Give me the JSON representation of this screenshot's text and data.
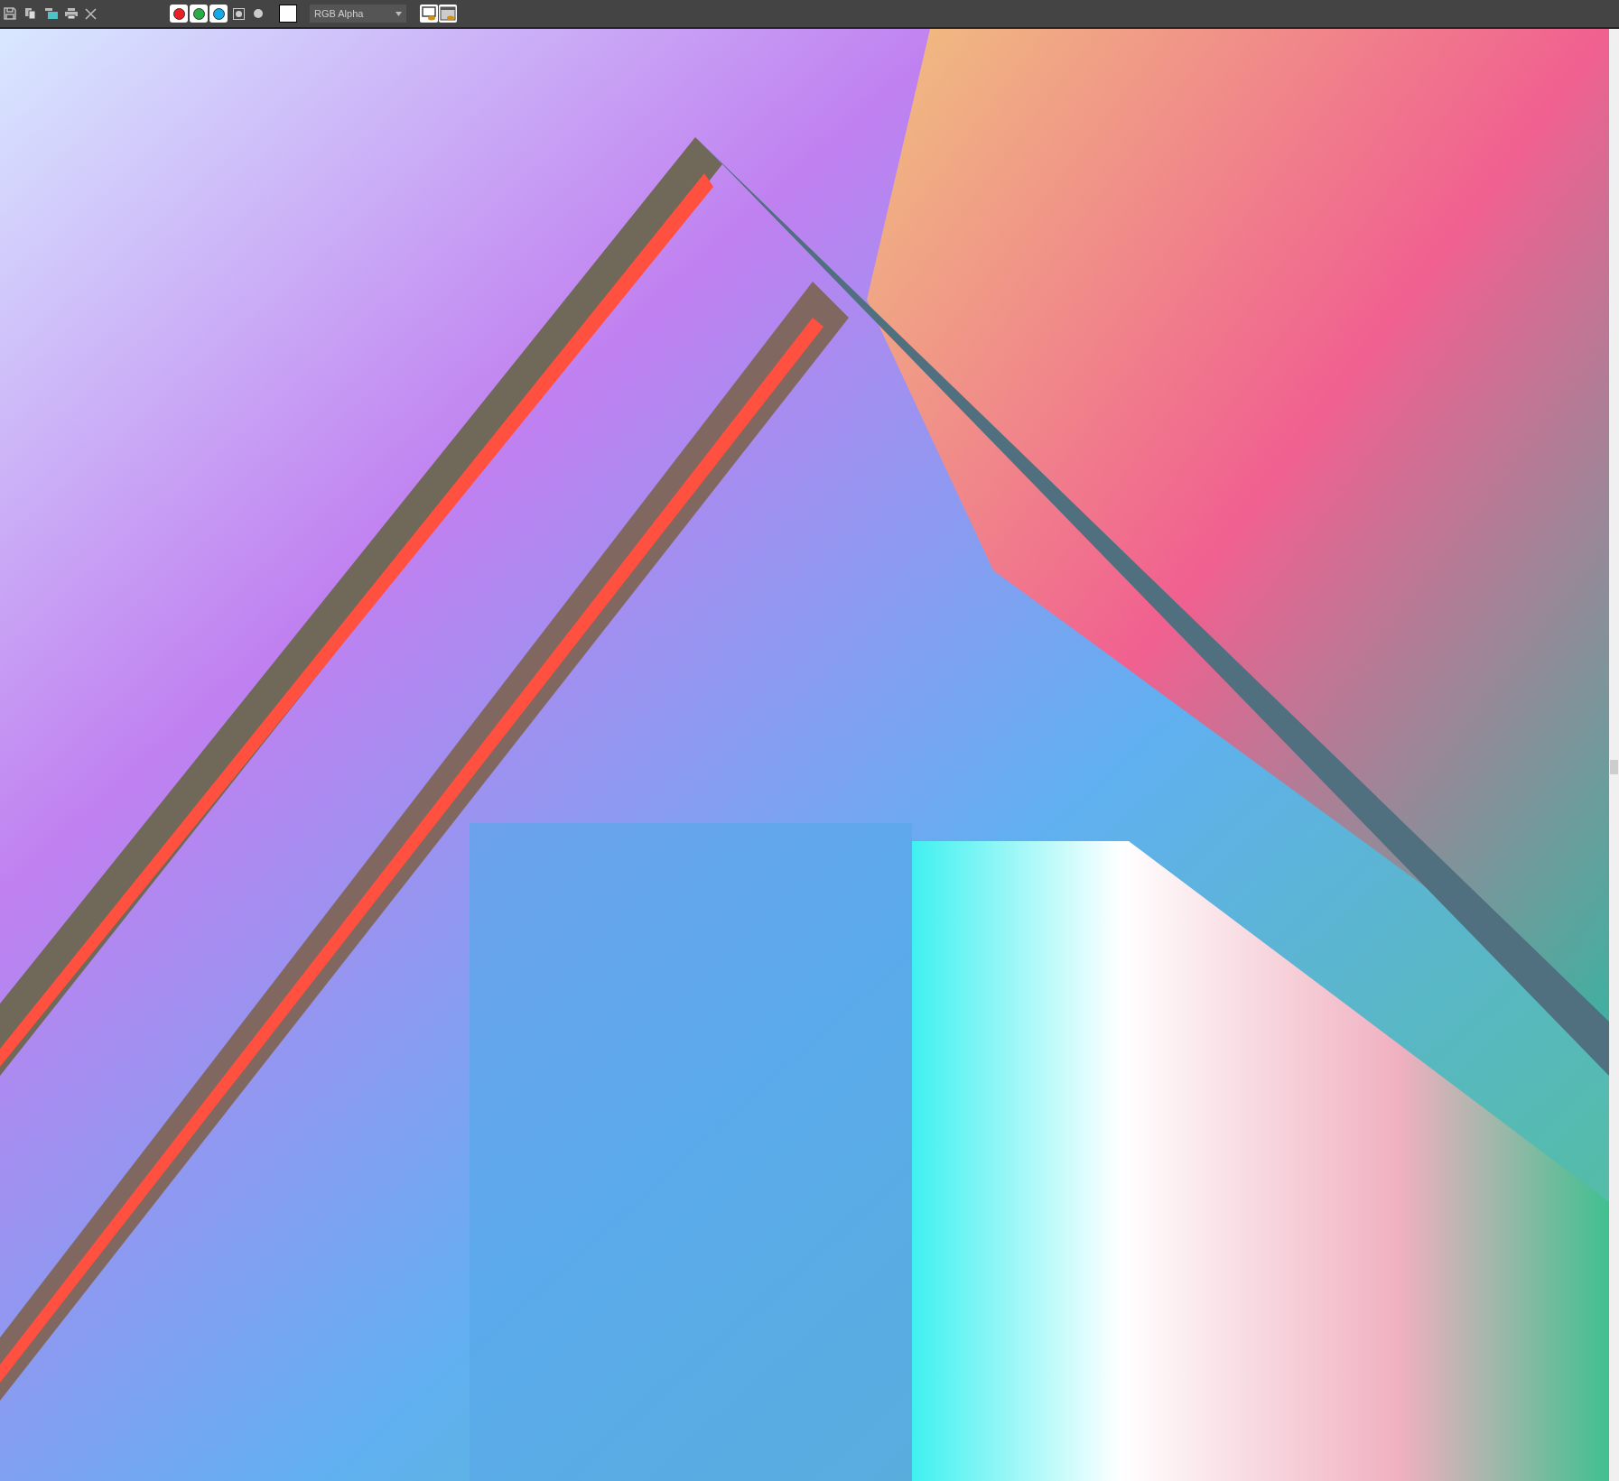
{
  "toolbar": {
    "channels": [
      {
        "kind": "color",
        "color": "#e8202a",
        "on": true
      },
      {
        "kind": "color",
        "color": "#2faa48",
        "on": true
      },
      {
        "kind": "color",
        "color": "#18a8e8",
        "on": true
      },
      {
        "kind": "alpha",
        "on": false
      },
      {
        "kind": "mono",
        "on": false
      }
    ],
    "display_dropdown": {
      "value": "RGB Alpha"
    }
  }
}
